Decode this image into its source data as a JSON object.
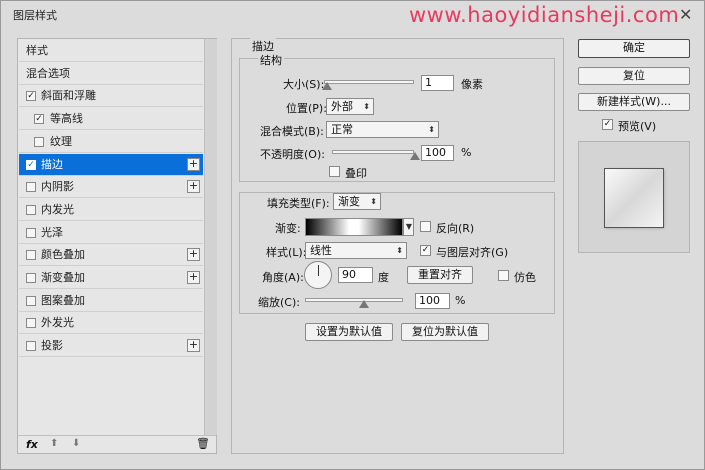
{
  "window": {
    "title": "图层样式",
    "watermark": "www.haoyidiansheji.com",
    "close_glyph": "✕"
  },
  "sidebar": {
    "items": [
      {
        "label": "样式",
        "checkbox": false,
        "plus": false,
        "checked": false,
        "indent": false
      },
      {
        "label": "混合选项",
        "checkbox": false,
        "plus": false,
        "checked": false,
        "indent": false
      },
      {
        "label": "斜面和浮雕",
        "checkbox": true,
        "plus": false,
        "checked": true,
        "indent": false
      },
      {
        "label": "等高线",
        "checkbox": true,
        "plus": false,
        "checked": true,
        "indent": true
      },
      {
        "label": "纹理",
        "checkbox": true,
        "plus": false,
        "checked": false,
        "indent": true
      },
      {
        "label": "描边",
        "checkbox": true,
        "plus": true,
        "checked": true,
        "indent": false,
        "selected": true
      },
      {
        "label": "内阴影",
        "checkbox": true,
        "plus": true,
        "checked": false,
        "indent": false
      },
      {
        "label": "内发光",
        "checkbox": true,
        "plus": false,
        "checked": false,
        "indent": false
      },
      {
        "label": "光泽",
        "checkbox": true,
        "plus": false,
        "checked": false,
        "indent": false
      },
      {
        "label": "颜色叠加",
        "checkbox": true,
        "plus": true,
        "checked": false,
        "indent": false
      },
      {
        "label": "渐变叠加",
        "checkbox": true,
        "plus": true,
        "checked": false,
        "indent": false
      },
      {
        "label": "图案叠加",
        "checkbox": true,
        "plus": false,
        "checked": false,
        "indent": false
      },
      {
        "label": "外发光",
        "checkbox": true,
        "plus": false,
        "checked": false,
        "indent": false
      },
      {
        "label": "投影",
        "checkbox": true,
        "plus": true,
        "checked": false,
        "indent": false
      }
    ],
    "footer": {
      "fx": "fx",
      "up": "⬆",
      "down": "⬇",
      "trash": "🗑"
    }
  },
  "stroke": {
    "section_title": "描边",
    "structure_title": "结构",
    "size_label": "大小(S):",
    "size_value": "1",
    "size_unit": "像素",
    "size_level": 0.01,
    "position_label": "位置(P):",
    "position_value": "外部",
    "blend_label": "混合模式(B):",
    "blend_value": "正常",
    "opacity_label": "不透明度(O):",
    "opacity_value": "100",
    "opacity_unit": "%",
    "opacity_level": 1.0,
    "overprint_label": "叠印",
    "fill_type_label": "填充类型(F):",
    "fill_type_value": "渐变",
    "gradient_label": "渐变:",
    "reverse_label": "反向(R)",
    "style_label": "样式(L):",
    "style_value": "线性",
    "align_label": "与图层对齐(G)",
    "angle_label": "角度(A):",
    "angle_value": "90",
    "angle_unit": "度",
    "reset_align_label": "重置对齐",
    "dither_label": "仿色",
    "scale_label": "缩放(C):",
    "scale_value": "100",
    "scale_unit": "%",
    "scale_level": 0.4,
    "set_default_label": "设置为默认值",
    "reset_default_label": "复位为默认值"
  },
  "actions": {
    "ok_label": "确定",
    "reset_label": "复位",
    "new_style_label": "新建样式(W)...",
    "preview_label": "预览(V)"
  },
  "colors": {
    "accent": "#0a6fd8",
    "watermark": "#e83a60"
  }
}
